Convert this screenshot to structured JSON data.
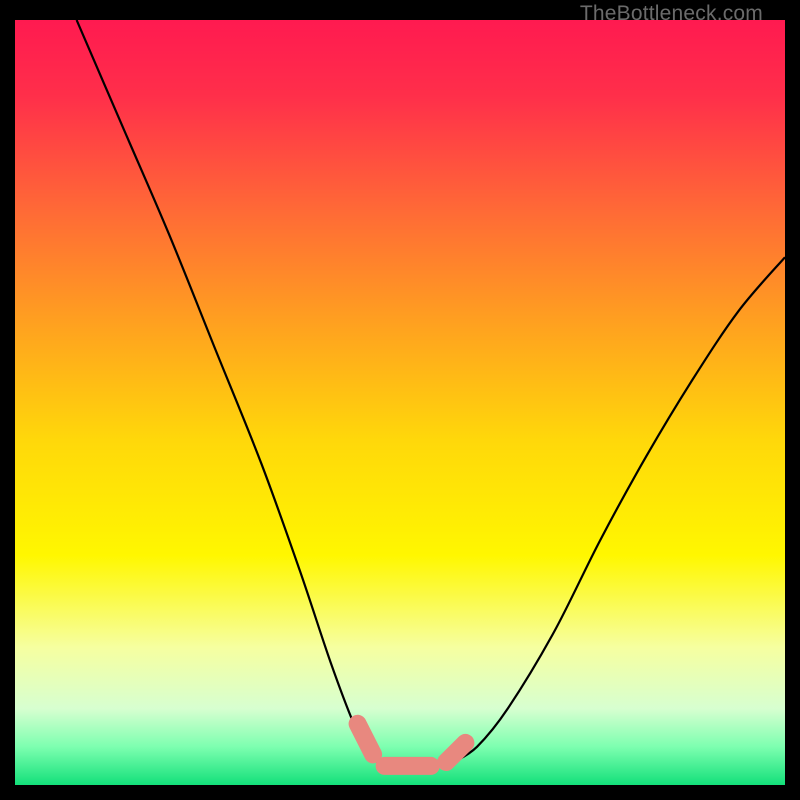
{
  "watermark": "TheBottleneck.com",
  "colors": {
    "frame": "#000000",
    "watermark_text": "#6b6b6b",
    "curve_stroke": "#000000",
    "marker_fill": "#e8887f",
    "marker_stroke": "#d4736a",
    "gradient_stops": [
      {
        "offset": 0.0,
        "color": "#ff1a50"
      },
      {
        "offset": 0.1,
        "color": "#ff2f4a"
      },
      {
        "offset": 0.25,
        "color": "#ff6a36"
      },
      {
        "offset": 0.4,
        "color": "#ffa21f"
      },
      {
        "offset": 0.55,
        "color": "#ffd80a"
      },
      {
        "offset": 0.7,
        "color": "#fff700"
      },
      {
        "offset": 0.82,
        "color": "#f6ffa0"
      },
      {
        "offset": 0.9,
        "color": "#d7ffd0"
      },
      {
        "offset": 0.95,
        "color": "#7dffb0"
      },
      {
        "offset": 1.0,
        "color": "#13e07a"
      }
    ]
  },
  "chart_data": {
    "type": "line",
    "title": "",
    "xlabel": "",
    "ylabel": "",
    "xlim": [
      0,
      100
    ],
    "ylim": [
      0,
      100
    ],
    "note": "V-shaped bottleneck deviation curve; y approximates percent deviation (0 = ideal match at green band, 100 = worst at top/red). x is a normalized axis 0–100. Values estimated from pixel positions.",
    "series": [
      {
        "name": "left-branch",
        "x": [
          8,
          14,
          20,
          26,
          32,
          37,
          41,
          44,
          46,
          47
        ],
        "y": [
          100,
          86,
          72,
          57,
          42,
          28,
          16,
          8,
          4,
          3
        ]
      },
      {
        "name": "right-branch",
        "x": [
          57,
          60,
          64,
          70,
          76,
          82,
          88,
          94,
          100
        ],
        "y": [
          3,
          5,
          10,
          20,
          32,
          43,
          53,
          62,
          69
        ]
      },
      {
        "name": "markers",
        "note": "Pale-red capsule markers near the trough; endpoints of each capsule segment.",
        "segments": [
          {
            "x": [
              44.5,
              46.5
            ],
            "y": [
              8.0,
              4.0
            ]
          },
          {
            "x": [
              48.0,
              54.0
            ],
            "y": [
              2.5,
              2.5
            ]
          },
          {
            "x": [
              56.0,
              58.5
            ],
            "y": [
              3.0,
              5.5
            ]
          }
        ]
      }
    ]
  }
}
